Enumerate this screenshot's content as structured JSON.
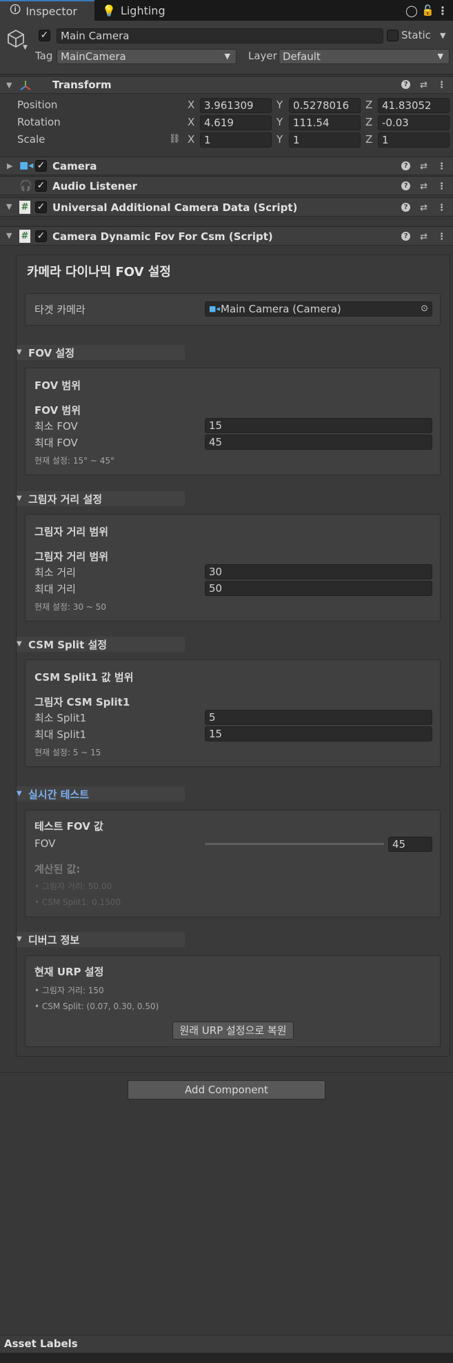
{
  "tabs": [
    {
      "label": "Inspector",
      "icon": "info-icon"
    },
    {
      "label": "Lighting",
      "icon": "bulb-icon"
    }
  ],
  "header": {
    "name": "Main Camera",
    "active": true,
    "static_label": "Static",
    "static_checked": false,
    "tag_label": "Tag",
    "tag_value": "MainCamera",
    "layer_label": "Layer",
    "layer_value": "Default"
  },
  "components": {
    "transform": {
      "title": "Transform",
      "position_label": "Position",
      "rotation_label": "Rotation",
      "scale_label": "Scale",
      "axes": [
        "X",
        "Y",
        "Z"
      ],
      "position": [
        "3.961309",
        "0.5278016",
        "41.83052"
      ],
      "rotation": [
        "4.619",
        "111.54",
        "-0.03"
      ],
      "scale": [
        "1",
        "1",
        "1"
      ]
    },
    "camera": {
      "title": "Camera",
      "enabled": true
    },
    "audio_listener": {
      "title": "Audio Listener",
      "enabled": true
    },
    "ucd": {
      "title": "Universal Additional Camera Data (Script)",
      "enabled": true
    },
    "fov_script": {
      "title": "Camera Dynamic Fov For Csm (Script)",
      "enabled": true
    }
  },
  "custom": {
    "main_title": "카메라 다이나믹 FOV 설정",
    "target_label": "타겟 카메라",
    "target_value": "Main Camera (Camera)",
    "fov": {
      "section": "FOV 설정",
      "box_title": "FOV 범위",
      "sub_title": "FOV 범위",
      "min_label": "최소 FOV",
      "min_value": "15",
      "max_label": "최대 FOV",
      "max_value": "45",
      "note": "현재 설정: 15° ~ 45°"
    },
    "shadow": {
      "section": "그림자 거리 설정",
      "box_title": "그림자 거리 범위",
      "sub_title": "그림자 거리 범위",
      "min_label": "최소 거리",
      "min_value": "30",
      "max_label": "최대 거리",
      "max_value": "50",
      "note": "현재 설정: 30 ~ 50"
    },
    "csm": {
      "section": "CSM Split 설정",
      "box_title": "CSM Split1 값 범위",
      "sub_title": "그림자 CSM Split1",
      "min_label": "최소 Split1",
      "min_value": "5",
      "max_label": "최대 Split1",
      "max_value": "15",
      "note": "현재 설정: 5 ~ 15"
    },
    "test": {
      "section": "실시간 테스트",
      "box_title": "테스트 FOV 값",
      "fov_label": "FOV",
      "fov_value": "45",
      "slider_fraction": 1.0,
      "computed_title": "계산된 값:",
      "computed_shadow": "• 그림자 거리: 50.00",
      "computed_split": "• CSM Split1: 0.1500"
    },
    "debug": {
      "section": "디버그 정보",
      "box_title": "현재 URP 설정",
      "shadow_line": "• 그림자 거리: 150",
      "split_line": "• CSM Split: (0.07, 0.30, 0.50)",
      "restore_button": "원래 URP 설정으로 복원"
    }
  },
  "add_component": "Add Component",
  "asset_labels": "Asset Labels",
  "colors": {
    "accent": "#3a79bb",
    "test_section": "#7cb0f0"
  }
}
